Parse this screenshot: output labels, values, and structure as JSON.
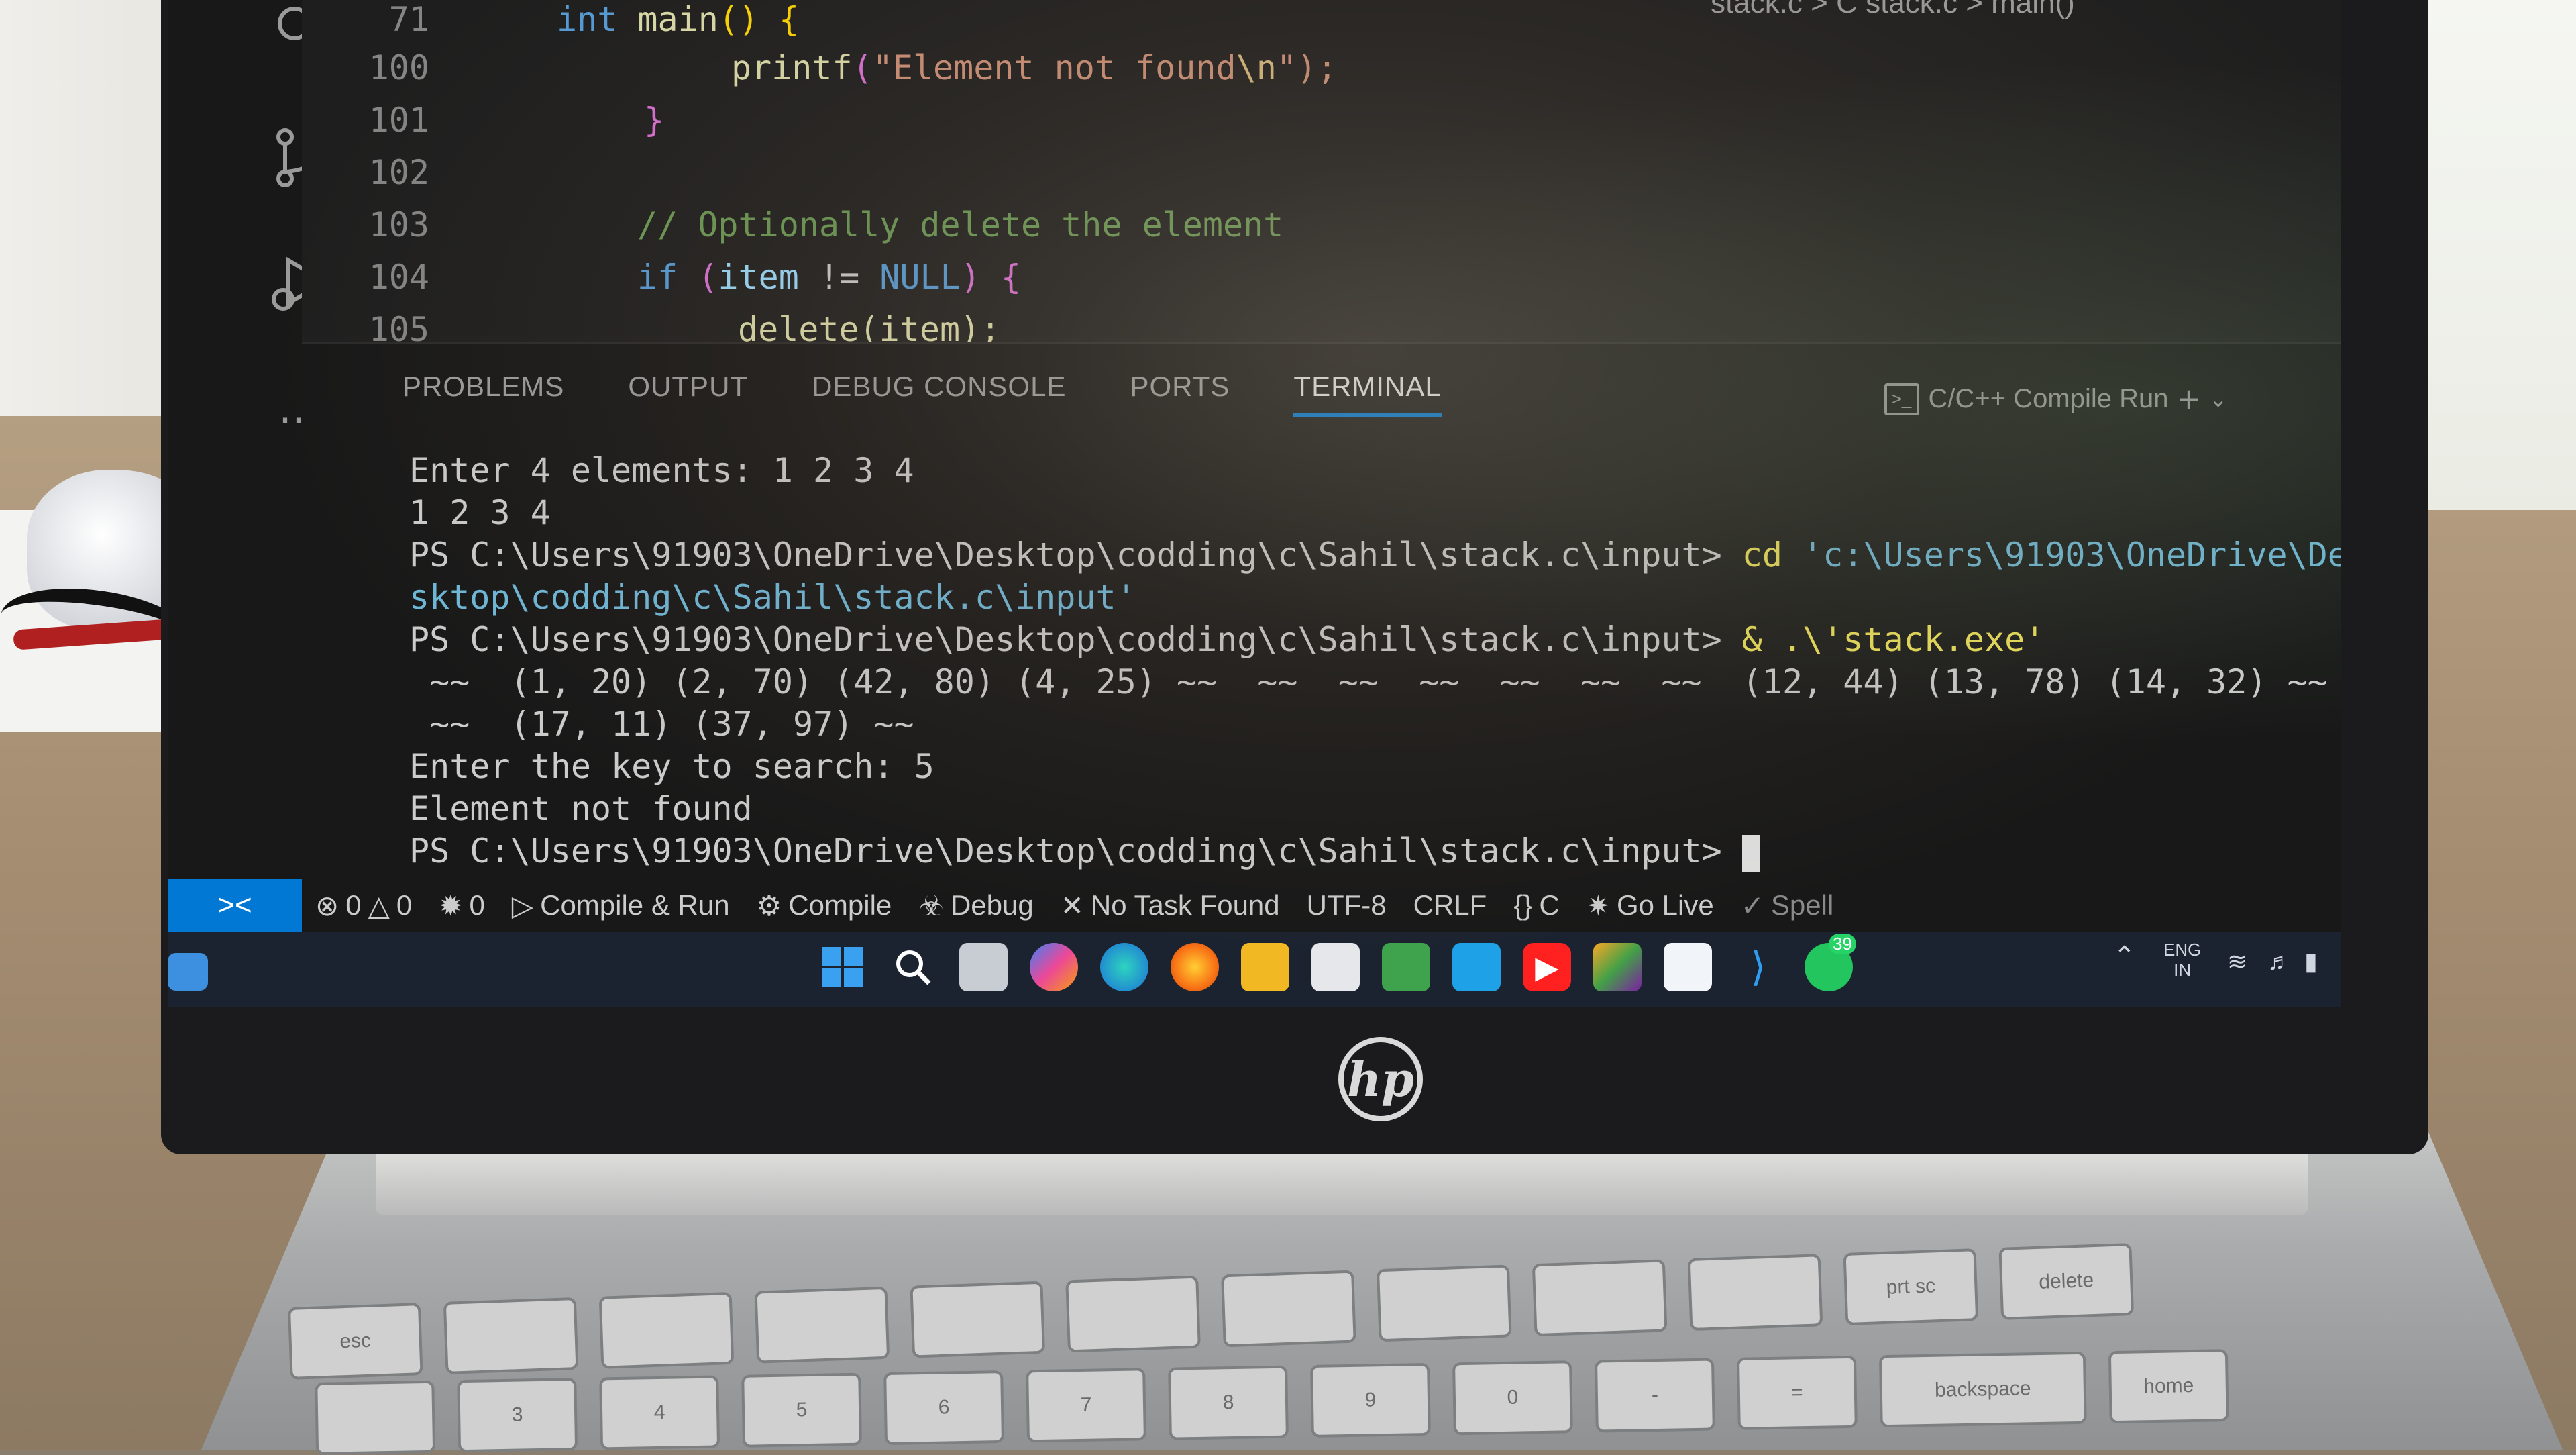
{
  "editor": {
    "breadcrumb": "stack.c > C stack.c > main()",
    "lines": [
      {
        "num": "71"
      },
      {
        "num": "100"
      },
      {
        "num": "101"
      },
      {
        "num": "102"
      },
      {
        "num": "103"
      },
      {
        "num": "104"
      },
      {
        "num": "105"
      }
    ],
    "code": {
      "l71_kw": "int",
      "l71_fn": "main",
      "l71_rest": "() {",
      "l100_fn": "printf",
      "l100_str": "\"Element not found",
      "l100_esc": "\\n",
      "l100_end": "\");",
      "l101": "}",
      "l103": "// Optionally delete the element",
      "l104_kw": "if",
      "l104_a": " (",
      "l104_var": "item",
      "l104_op": " != ",
      "l104_null": "NULL",
      "l104_b": ") {",
      "l105": "delete(item);"
    }
  },
  "panel": {
    "tabs": [
      {
        "label": "PROBLEMS"
      },
      {
        "label": "OUTPUT"
      },
      {
        "label": "DEBUG CONSOLE"
      },
      {
        "label": "PORTS"
      },
      {
        "label": "TERMINAL"
      }
    ],
    "active_tab": "TERMINAL",
    "task_label": "C/C++ Compile Run",
    "add_symbol": "+"
  },
  "terminal": {
    "l1": "Enter 4 elements: 1 2 3 4",
    "l2": "1 2 3 4",
    "l3_prompt": "PS C:\\Users\\91903\\OneDrive\\Desktop\\codding\\c\\Sahil\\stack.c\\input> ",
    "l3_cmd": "cd",
    "l3_path": " 'c:\\Users\\91903\\OneDrive\\De",
    "l4_path": "sktop\\codding\\c\\Sahil\\stack.c\\input'",
    "l5_prompt": "PS C:\\Users\\91903\\OneDrive\\Desktop\\codding\\c\\Sahil\\stack.c\\input> ",
    "l5_cmd": "& .\\'stack.exe'",
    "l6": " ~~  (1, 20) (2, 70) (42, 80) (4, 25) ~~  ~~  ~~  ~~  ~~  ~~  ~~  (12, 44) (13, 78) (14, 32) ~~",
    "l7": " ~~  (17, 11) (37, 97) ~~",
    "l8": "Enter the key to search: 5",
    "l9": "Element not found",
    "l10_prompt": "PS C:\\Users\\91903\\OneDrive\\Desktop\\codding\\c\\Sahil\\stack.c\\input> "
  },
  "statusbar": {
    "errors": "0",
    "warnings": "0",
    "ports": "0",
    "compile_run": "Compile & Run",
    "compile": "Compile",
    "debug": "Debug",
    "task": "No Task Found",
    "encoding": "UTF-8",
    "eol": "CRLF",
    "language": "C",
    "go_live": "Go Live",
    "spell": "Spell"
  },
  "taskbar": {
    "lang_top": "ENG",
    "lang_bottom": "IN",
    "badge": "39"
  },
  "device": {
    "brand": "hp"
  },
  "keyboard": {
    "top_keys": [
      "esc",
      "backspace",
      "home",
      "prt sc",
      "delete"
    ],
    "num_keys": [
      "#",
      "3",
      "$",
      "4",
      "%",
      "5",
      "^",
      "6",
      "&",
      "7",
      "*",
      "8",
      "(",
      "9",
      ")",
      "0",
      "-",
      "=",
      "+"
    ]
  },
  "colors": {
    "accent": "#0078d4",
    "editor_bg": "#1e1e1e",
    "panel_bg": "#181818",
    "taskbar_bg": "#1c2330"
  }
}
